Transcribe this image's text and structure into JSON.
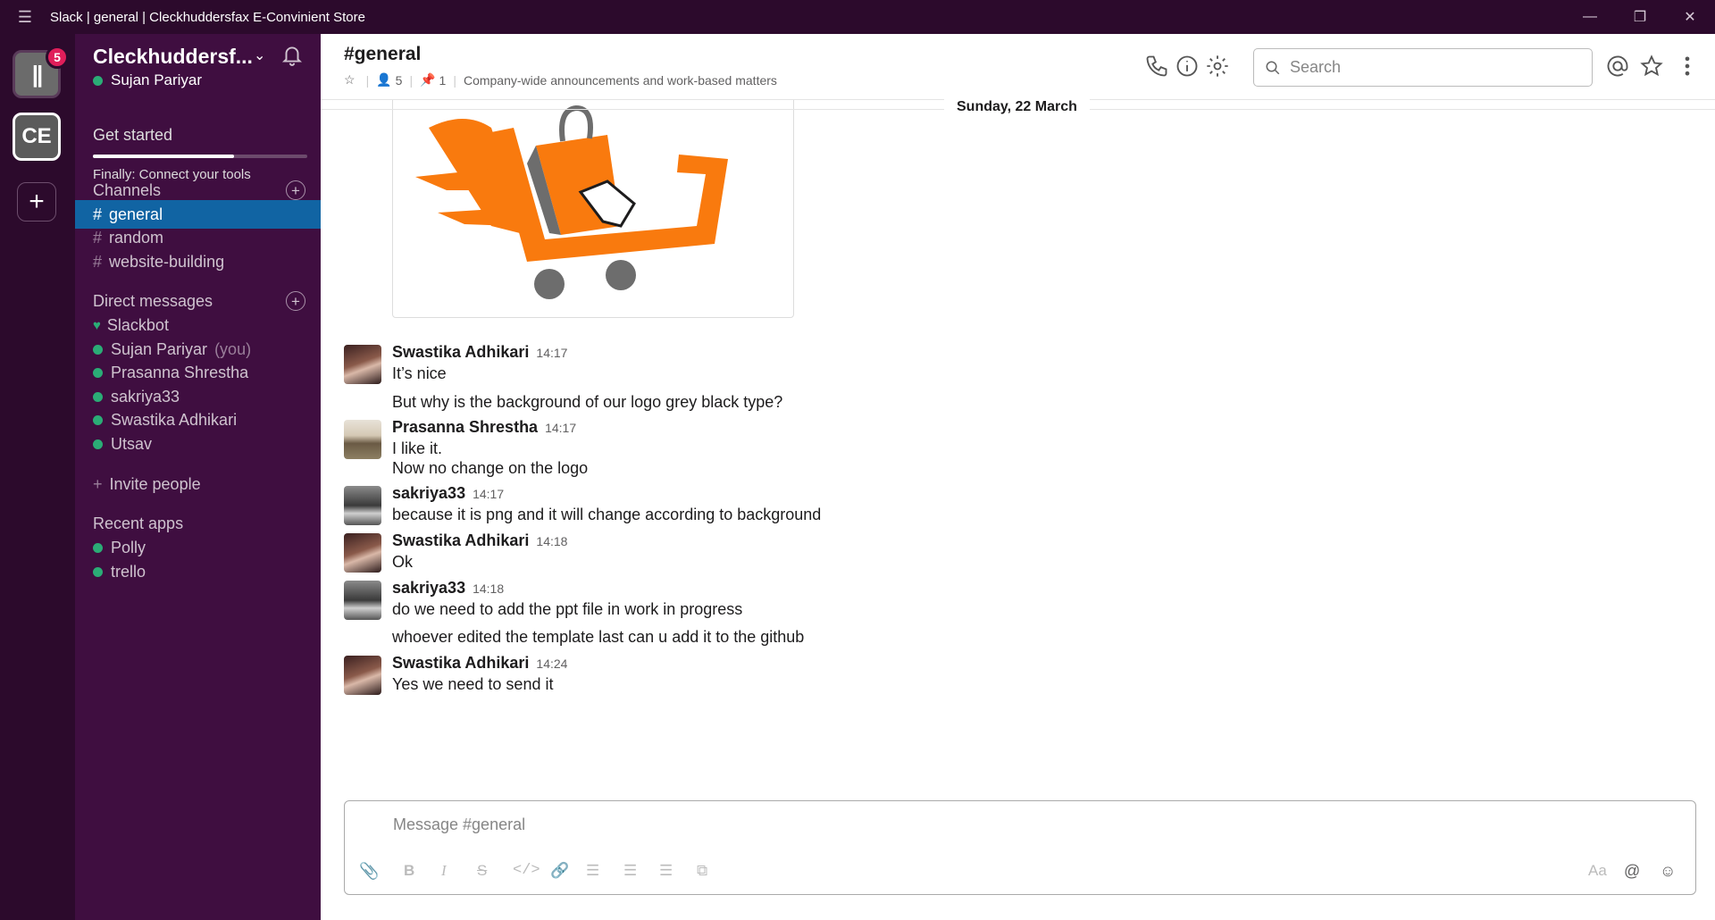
{
  "window": {
    "title": "Slack | general | Cleckhuddersfax E-Convinient Store",
    "menu_icon": "hamburger-icon",
    "minimize_icon": "minimize-icon",
    "restore_icon": "restore-icon",
    "close_icon": "close-icon"
  },
  "rail": {
    "workspace1_badge": "5",
    "workspace2_initials": "CE",
    "add_label": "+"
  },
  "sidebar": {
    "team_name": "Cleckhuddersf...",
    "user": "Sujan Pariyar",
    "get_started": {
      "title": "Get started",
      "subtitle": "Finally: Connect your tools",
      "progress": 0.66
    },
    "channels_title": "Channels",
    "channels": [
      {
        "name": "general",
        "active": true
      },
      {
        "name": "random",
        "active": false
      },
      {
        "name": "website-building",
        "active": false
      }
    ],
    "dm_title": "Direct messages",
    "dms": [
      {
        "name": "Slackbot"
      },
      {
        "name": "Sujan Pariyar",
        "suffix": "(you)"
      },
      {
        "name": "Prasanna Shrestha"
      },
      {
        "name": "sakriya33"
      },
      {
        "name": "Swastika Adhikari"
      },
      {
        "name": "Utsav"
      }
    ],
    "invite": "Invite people",
    "apps_title": "Recent apps",
    "apps": [
      {
        "name": "Polly"
      },
      {
        "name": "trello"
      }
    ],
    "accent_active": "#1164a3",
    "bg": "#3f0e40"
  },
  "header": {
    "channel": "#general",
    "members": "5",
    "pins": "1",
    "topic": "Company-wide announcements and work-based matters",
    "search_placeholder": "Search"
  },
  "date_divider": "Sunday, 22 March",
  "messages": [
    {
      "author": "Swastika Adhikari",
      "time": "14:17",
      "lines": [
        "It’s nice",
        "But why is the background of our logo grey black type?"
      ]
    },
    {
      "author": "Prasanna Shrestha",
      "time": "14:17",
      "lines": [
        "I like it.",
        "Now no change on the logo"
      ]
    },
    {
      "author": "sakriya33",
      "time": "14:17",
      "lines": [
        "because it is png and it will change according to background"
      ]
    },
    {
      "author": "Swastika Adhikari",
      "time": "14:18",
      "lines": [
        "Ok"
      ]
    },
    {
      "author": "sakriya33",
      "time": "14:18",
      "lines": [
        "do we need to add the ppt file in work in progress",
        "whoever edited the template last can u add it to the github"
      ]
    },
    {
      "author": "Swastika Adhikari",
      "time": "14:24",
      "lines": [
        "Yes we need to send it"
      ]
    }
  ],
  "composer": {
    "placeholder": "Message #general",
    "aa": "Aa",
    "at": "@"
  },
  "logo_colors": {
    "orange": "#f97a0e",
    "grey": "#6d6d6d"
  }
}
